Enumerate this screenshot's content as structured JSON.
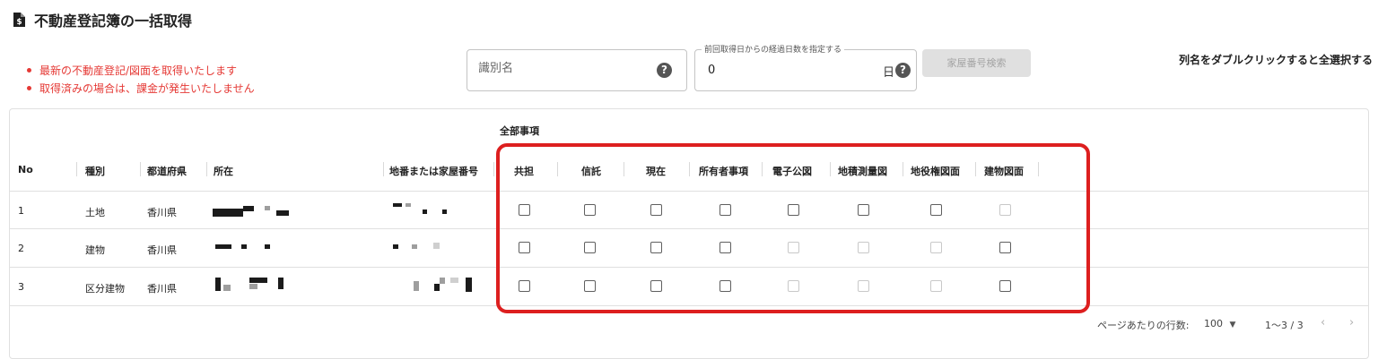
{
  "page": {
    "title": "不動産登記簿の一括取得",
    "notes": [
      "最新の不動産登記/図面を取得いたします",
      "取得済みの場合は、課金が発生いたしません"
    ],
    "dblclick_hint": "列名をダブルクリックすると全選択する"
  },
  "filters": {
    "identifier_placeholder": "識別名",
    "days_label": "前回取得日からの経過日数を指定する",
    "days_value": "0",
    "days_unit": "日",
    "house_number_search_label": "家屋番号検索"
  },
  "table": {
    "group_header": "全部事項",
    "columns": [
      "No",
      "種別",
      "都道府県",
      "所在",
      "地番または家屋番号",
      "共担",
      "信託",
      "現在",
      "所有者事項",
      "電子公図",
      "地積測量図",
      "地役権図面",
      "建物図面"
    ],
    "rows": [
      {
        "no": "1",
        "type": "土地",
        "prefecture": "香川県",
        "checks": [
          false,
          false,
          false,
          false,
          false,
          false,
          false,
          false
        ],
        "disabled": [
          false,
          false,
          false,
          false,
          false,
          false,
          false,
          true
        ]
      },
      {
        "no": "2",
        "type": "建物",
        "prefecture": "香川県",
        "checks": [
          false,
          false,
          false,
          false,
          false,
          false,
          false,
          false
        ],
        "disabled": [
          false,
          false,
          false,
          false,
          true,
          true,
          true,
          false
        ]
      },
      {
        "no": "3",
        "type": "区分建物",
        "prefecture": "香川県",
        "checks": [
          false,
          false,
          false,
          false,
          false,
          false,
          false,
          false
        ],
        "disabled": [
          false,
          false,
          false,
          false,
          true,
          true,
          true,
          false
        ]
      }
    ]
  },
  "pagination": {
    "rows_per_page_label": "ページあたりの行数:",
    "rows_per_page_value": "100",
    "range": "1～3 / 3"
  },
  "icons": {
    "title": "document-yen-icon",
    "help": "help-circle-icon",
    "dropdown": "caret-down-icon",
    "prev": "chevron-left-icon",
    "next": "chevron-right-icon"
  },
  "colors": {
    "alert_text": "#e53935",
    "highlight_border": "#dd1f1f",
    "disabled_button": "#e0e0e0"
  }
}
